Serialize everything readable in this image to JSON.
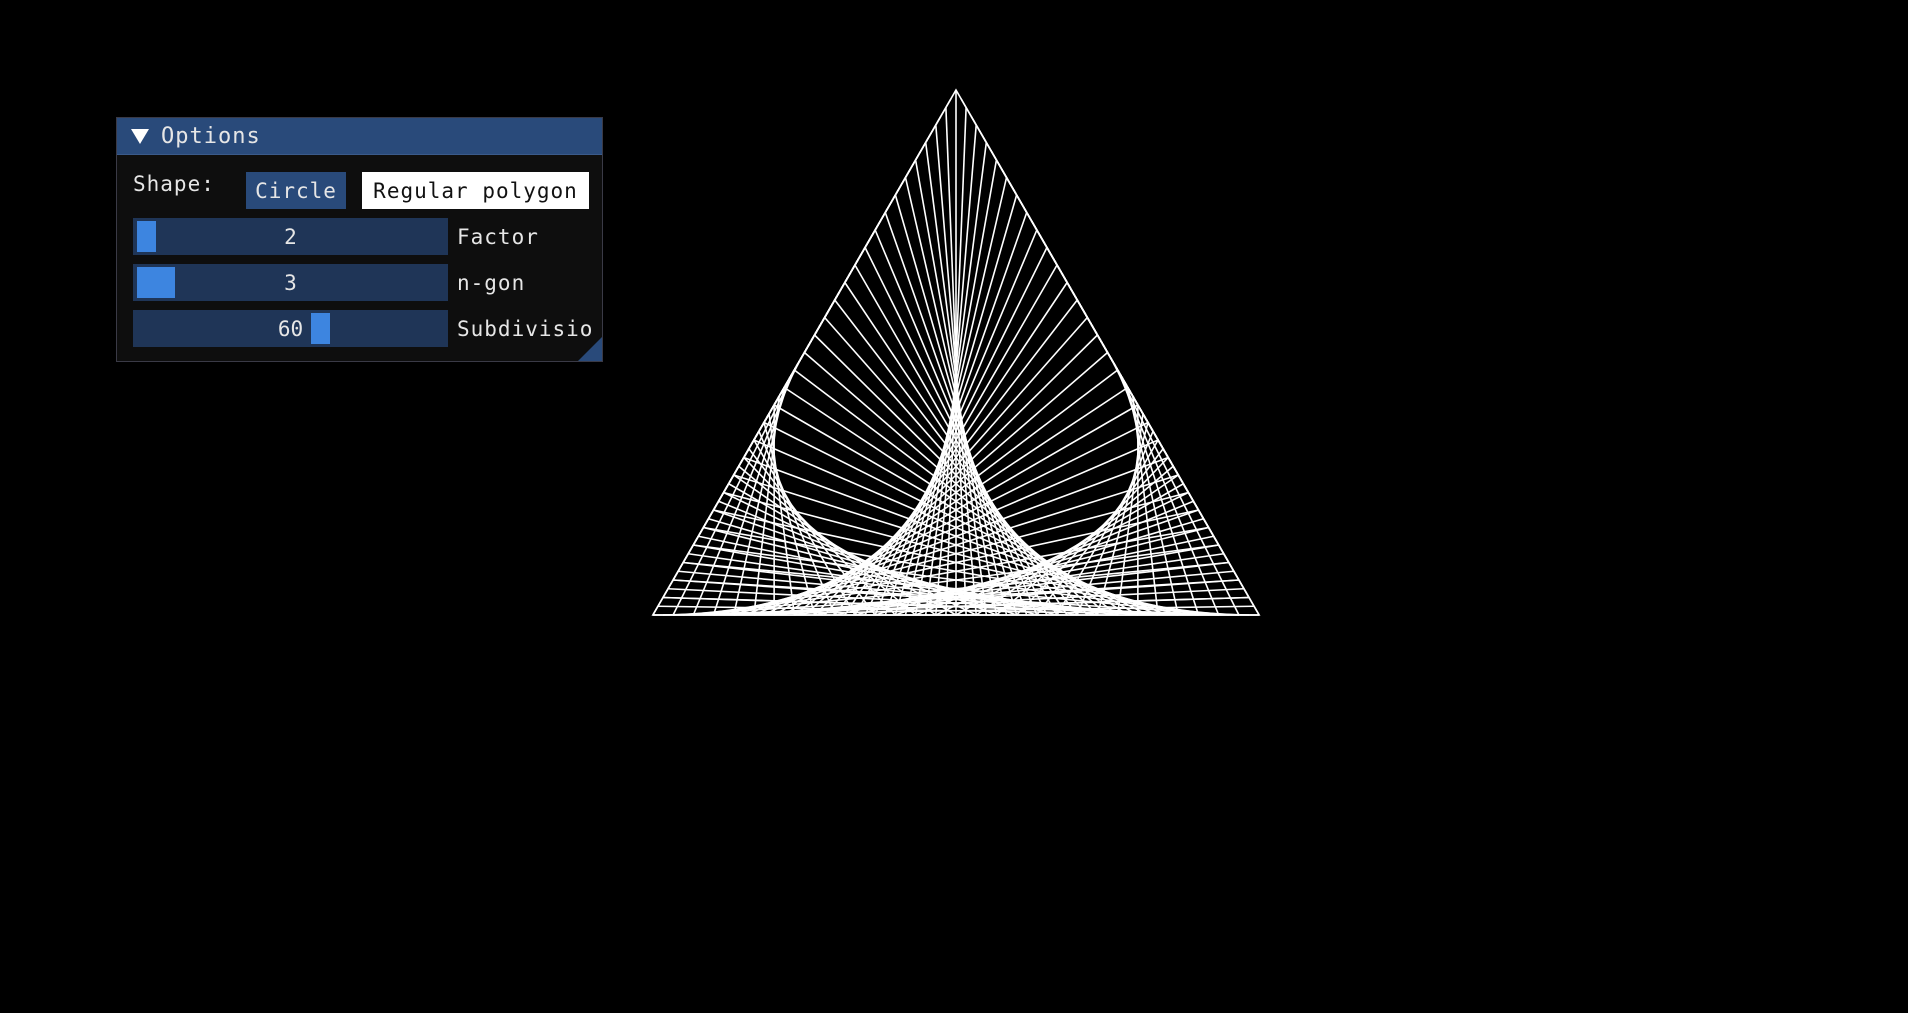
{
  "window": {
    "title": "Options",
    "shape_label": "Shape:",
    "shape_options": [
      "Circle",
      "Regular polygon"
    ],
    "selected_shape": "Regular polygon",
    "sliders": [
      {
        "label": "Factor",
        "value": "2",
        "fraction": 0.02
      },
      {
        "label": "n-gon",
        "value": "3",
        "fraction": 0.0
      },
      {
        "label": "Subdivisio",
        "value": "60",
        "fraction": 0.5
      }
    ]
  },
  "drawing": {
    "shape": "regular polygon",
    "n_gon": 3,
    "factor": 2,
    "subdivisions": 60,
    "line_color": "#ffffff",
    "background_color": "#000000"
  },
  "colors": {
    "title_bar": "#294a7a",
    "slider_bg": "#1f3557",
    "slider_grab": "#3d85e0",
    "button_inactive": "#294a7a",
    "button_active": "#ffffff"
  }
}
